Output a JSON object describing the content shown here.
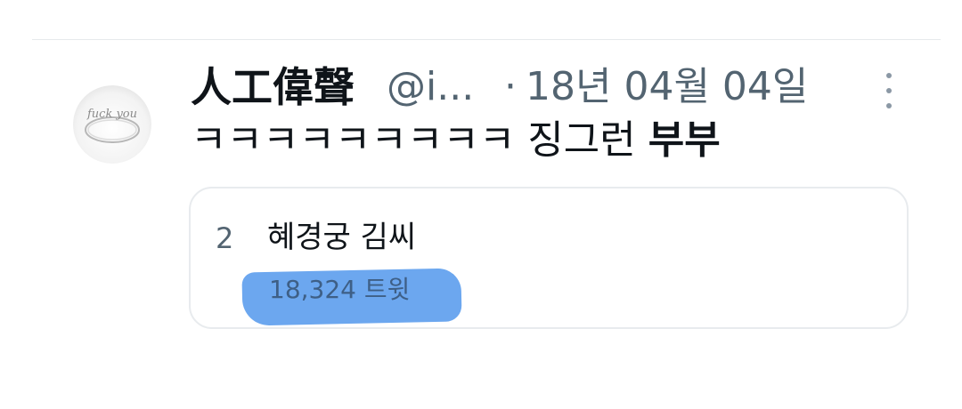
{
  "tweet": {
    "display_name": "人工偉聲",
    "handle": "@i...",
    "separator": "·",
    "date": "18년 04월 04일",
    "text_plain": "ㅋㅋㅋㅋㅋㅋㅋㅋㅋ 징그런 ",
    "text_bold": "부부",
    "avatar": {
      "icon": "ring-photo-avatar",
      "text": "fuck you"
    },
    "more_icon": "more-vertical-icon"
  },
  "quote_card": {
    "rank": "2",
    "name": "혜경궁 김씨",
    "count": "18,324 트윗",
    "highlight_color": "#5f9fee"
  }
}
